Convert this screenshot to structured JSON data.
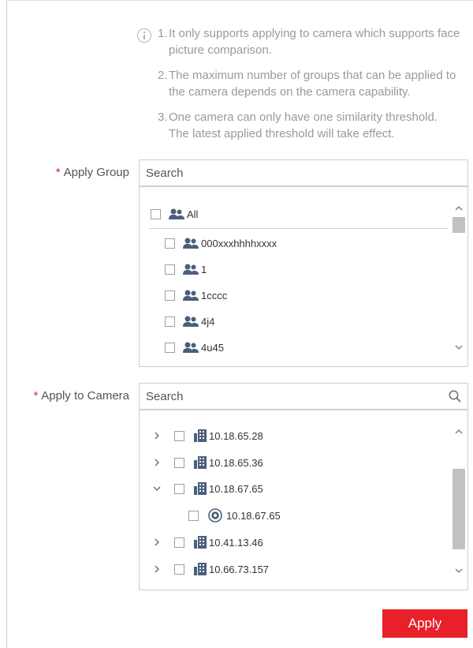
{
  "notes": [
    {
      "num": "1.",
      "text": "It only supports applying to camera which supports face picture comparison."
    },
    {
      "num": "2.",
      "text": "The maximum number of groups that can be applied to the camera depends on the camera capability."
    },
    {
      "num": "3.",
      "text": "One camera can only have one similarity threshold. The latest applied threshold will take effect."
    }
  ],
  "apply_group": {
    "required_mark": "*",
    "label": "Apply Group",
    "search_placeholder": "Search",
    "all_label": "All",
    "groups": [
      "000xxxhhhhxxxx",
      "1",
      "1cccc",
      "4j4",
      "4u45"
    ]
  },
  "apply_camera": {
    "required_mark": "*",
    "label": "Apply to Camera",
    "search_placeholder": "Search",
    "devices": [
      {
        "label": "10.18.65.28",
        "expanded": false
      },
      {
        "label": "10.18.65.36",
        "expanded": false
      },
      {
        "label": "10.18.67.65",
        "expanded": true
      },
      {
        "label": "10.41.13.46",
        "expanded": false
      },
      {
        "label": "10.66.73.157",
        "expanded": false
      }
    ],
    "camera_channel": "10.18.67.65"
  },
  "apply_button": "Apply",
  "colors": {
    "accent": "#e8202a",
    "icon": "#4a5f7a",
    "border": "#cfcfcf",
    "note_text": "#9a9a9a"
  }
}
